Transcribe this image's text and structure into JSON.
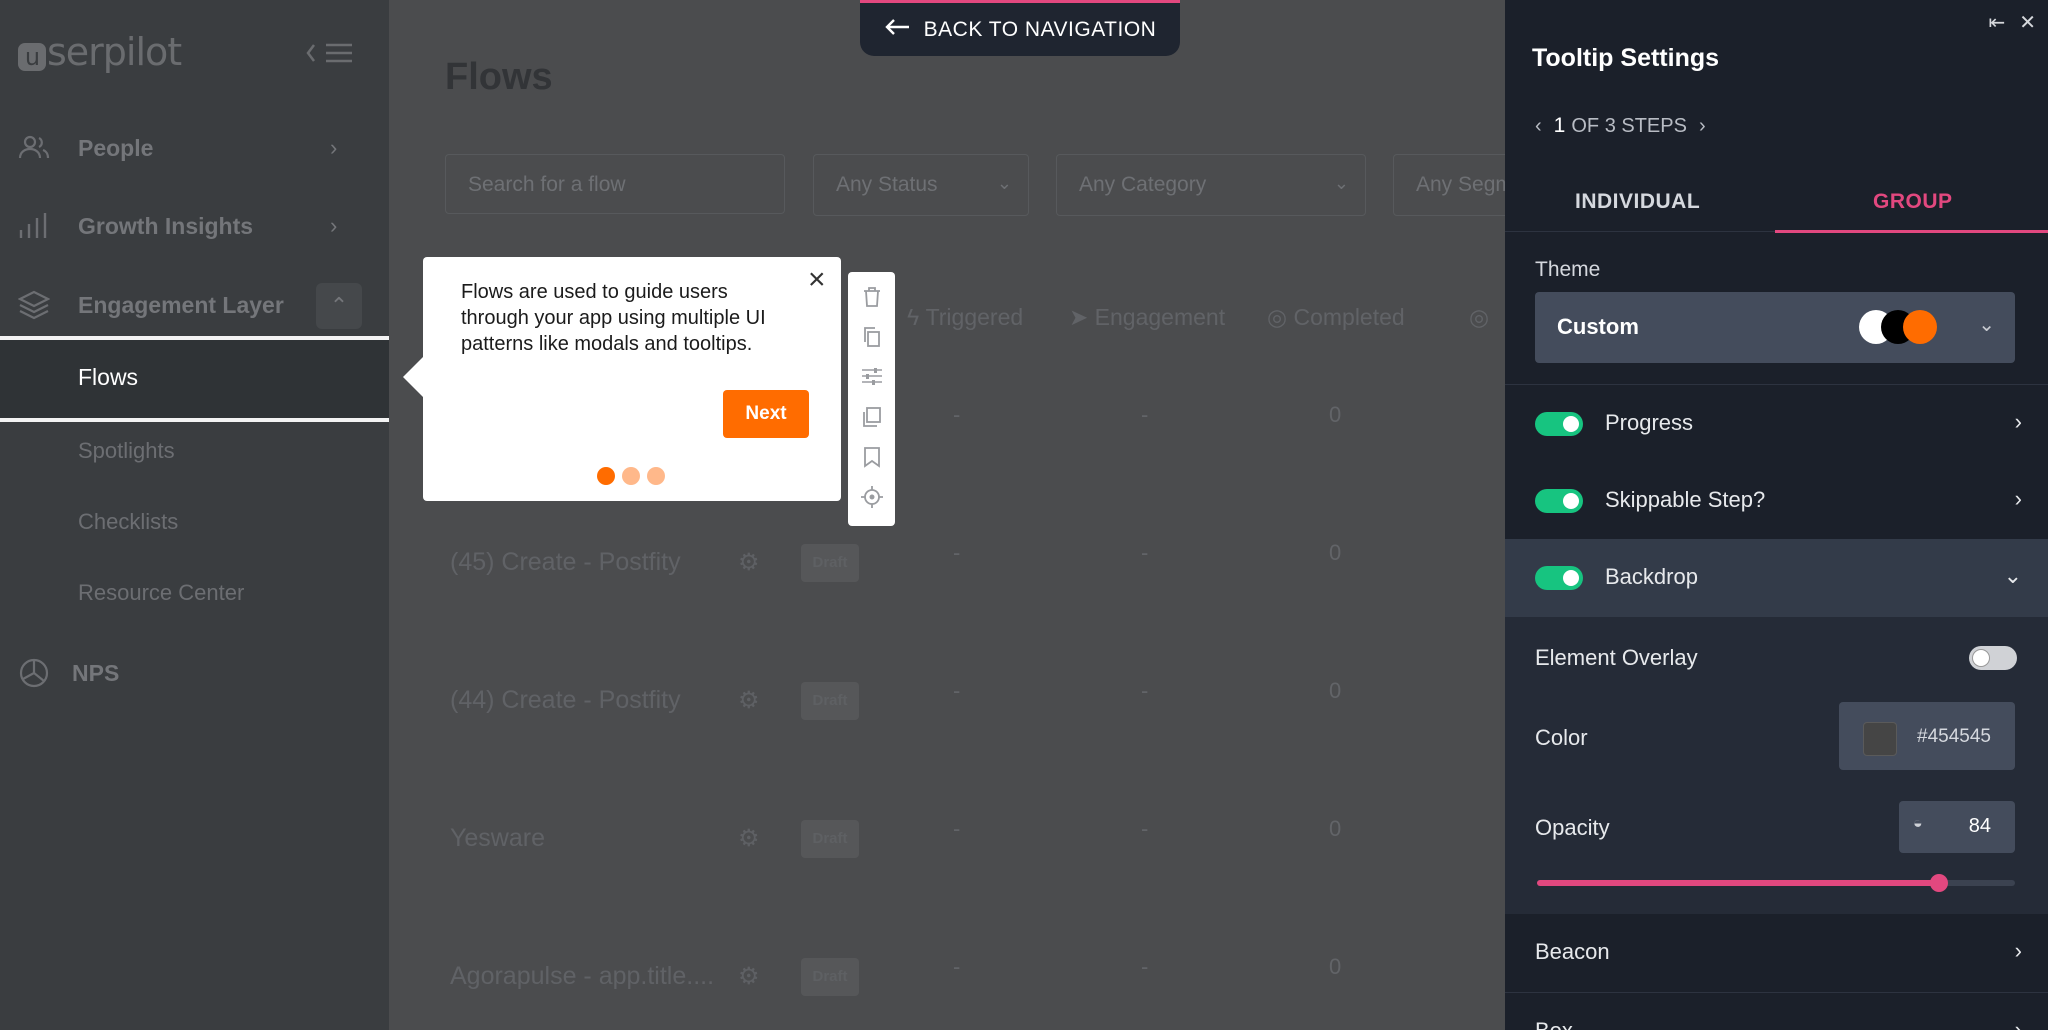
{
  "sidebar": {
    "logo_mark": "u",
    "logo_rest": "serpilot",
    "nav": [
      {
        "label": "People",
        "icon": "people-icon"
      },
      {
        "label": "Growth Insights",
        "icon": "bar-chart-icon"
      },
      {
        "label": "Engagement Layer",
        "icon": "layers-icon"
      },
      {
        "label": "NPS",
        "icon": "nps-icon"
      }
    ],
    "sub": [
      "Flows",
      "Spotlights",
      "Checklists",
      "Resource Center"
    ]
  },
  "main": {
    "title": "Flows",
    "search_placeholder": "Search for a flow",
    "filters": [
      "Any Status",
      "Any Category",
      "Any Segm"
    ],
    "columns": [
      "Triggered",
      "Engagement",
      "Completed"
    ],
    "rows": [
      {
        "name": "",
        "triggered": "-",
        "engagement": "-",
        "completed": "0"
      },
      {
        "name": "(45) Create - Postfity",
        "status": "Draft",
        "triggered": "-",
        "engagement": "-",
        "completed": "0"
      },
      {
        "name": "(44) Create - Postfity",
        "status": "Draft",
        "triggered": "-",
        "engagement": "-",
        "completed": "0"
      },
      {
        "name": "Yesware",
        "status": "Draft",
        "triggered": "-",
        "engagement": "-",
        "completed": "0"
      },
      {
        "name": "Agorapulse - app.title....",
        "status": "Draft",
        "triggered": "-",
        "engagement": "-",
        "completed": "0"
      }
    ]
  },
  "back_button": {
    "label": "BACK TO NAVIGATION"
  },
  "tooltip": {
    "text": "Flows are used to guide users through your app using multiple UI patterns like modals and tooltips.",
    "next_label": "Next",
    "step_colors": [
      "#ff6c00",
      "#ffb88a",
      "#ffb88a"
    ]
  },
  "panel": {
    "title": "Tooltip Settings",
    "step_current": "1",
    "step_text": "OF 3 STEPS",
    "tabs": [
      "INDIVIDUAL",
      "GROUP"
    ],
    "active_tab": "GROUP",
    "theme_label": "Theme",
    "theme_value": "Custom",
    "theme_swatches": [
      "#ffffff",
      "#000000",
      "#ff6c00"
    ],
    "sections": [
      {
        "label": "Progress",
        "enabled": true
      },
      {
        "label": "Skippable Step?",
        "enabled": true
      },
      {
        "label": "Backdrop",
        "enabled": true
      }
    ],
    "element_overlay_label": "Element Overlay",
    "element_overlay_on": false,
    "color_label": "Color",
    "color_value": "#454545",
    "opacity_label": "Opacity",
    "opacity_value": "84",
    "opacity_fraction": 0.84,
    "beacon_label": "Beacon",
    "box_label": "Box"
  },
  "colors": {
    "accent": "#e2487f",
    "brand_orange": "#ff6c00",
    "toggle_on": "#17c480"
  }
}
